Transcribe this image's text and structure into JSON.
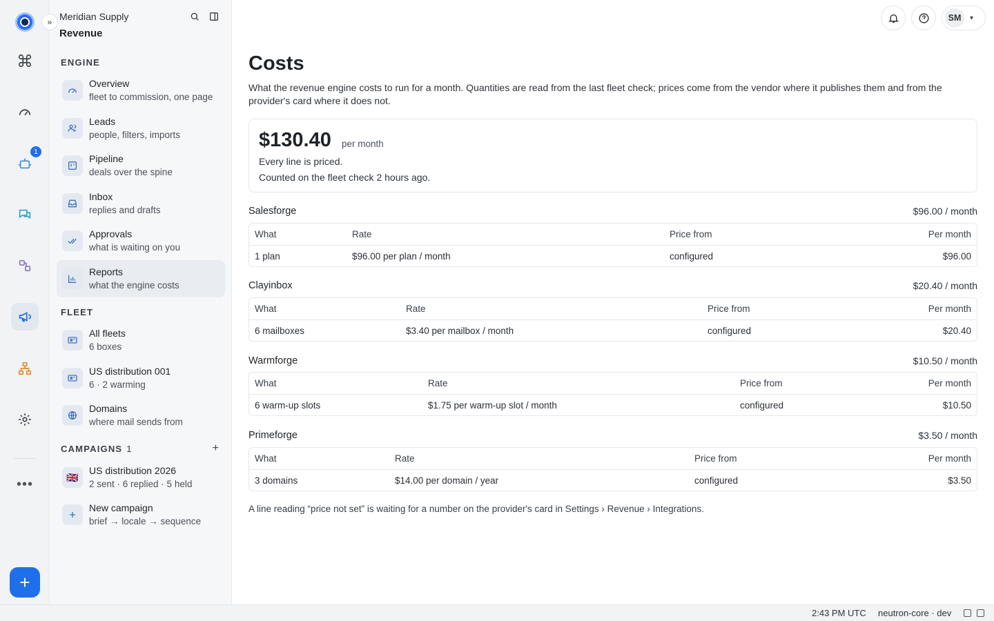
{
  "rail": {
    "badge_count": "1",
    "icons": [
      "command-icon",
      "gauge-icon",
      "robot-icon",
      "chat-icon",
      "workflow-icon",
      "megaphone-icon",
      "org-chart-icon",
      "gear-icon"
    ]
  },
  "sidebar": {
    "org": "Meridian Supply",
    "product": "Revenue",
    "engine_section": "ENGINE",
    "engine_items": [
      {
        "title": "Overview",
        "subtitle": "fleet to commission, one page"
      },
      {
        "title": "Leads",
        "subtitle": "people, filters, imports"
      },
      {
        "title": "Pipeline",
        "subtitle": "deals over the spine"
      },
      {
        "title": "Inbox",
        "subtitle": "replies and drafts"
      },
      {
        "title": "Approvals",
        "subtitle": "what is waiting on you"
      },
      {
        "title": "Reports",
        "subtitle": "what the engine costs"
      }
    ],
    "fleet_section": "FLEET",
    "fleet_items": [
      {
        "title": "All fleets",
        "subtitle": "6 boxes"
      },
      {
        "title": "US distribution 001",
        "subtitle": "6 · 2 warming"
      },
      {
        "title": "Domains",
        "subtitle": "where mail sends from"
      }
    ],
    "campaigns_section": "CAMPAIGNS",
    "campaigns_count": "1",
    "campaign_items": [
      {
        "title": "US distribution 2026",
        "subtitle": "2 sent · 6 replied · 5 held",
        "flag": "🇬🇧"
      },
      {
        "title": "New campaign",
        "subtitle": "brief → locale → sequence"
      }
    ]
  },
  "header": {
    "avatar_initials": "SM"
  },
  "page": {
    "title": "Costs",
    "description": "What the revenue engine costs to run for a month. Quantities are read from the last fleet check; prices come from the vendor where it publishes them and from the provider's card where it does not.",
    "summary": {
      "amount": "$130.40",
      "per": "per month",
      "line1": "Every line is priced.",
      "line2": "Counted on the fleet check 2 hours ago."
    },
    "columns": {
      "what": "What",
      "rate": "Rate",
      "price_from": "Price from",
      "per_month": "Per month"
    },
    "vendors": [
      {
        "name": "Salesforge",
        "total": "$96.00 / month",
        "what": "1 plan",
        "rate": "$96.00 per plan / month",
        "price_from": "configured",
        "per_month": "$96.00"
      },
      {
        "name": "Clayinbox",
        "total": "$20.40 / month",
        "what": "6 mailboxes",
        "rate": "$3.40 per mailbox / month",
        "price_from": "configured",
        "per_month": "$20.40"
      },
      {
        "name": "Warmforge",
        "total": "$10.50 / month",
        "what": "6 warm-up slots",
        "rate": "$1.75 per warm-up slot / month",
        "price_from": "configured",
        "per_month": "$10.50"
      },
      {
        "name": "Primeforge",
        "total": "$3.50 / month",
        "what": "3 domains",
        "rate": "$14.00 per domain / year",
        "price_from": "configured",
        "per_month": "$3.50"
      }
    ],
    "footnote": "A line reading “price not set” is waiting for a number on the provider's card in Settings › Revenue › Integrations."
  },
  "status": {
    "time": "2:43 PM UTC",
    "env": "neutron-core · dev"
  }
}
